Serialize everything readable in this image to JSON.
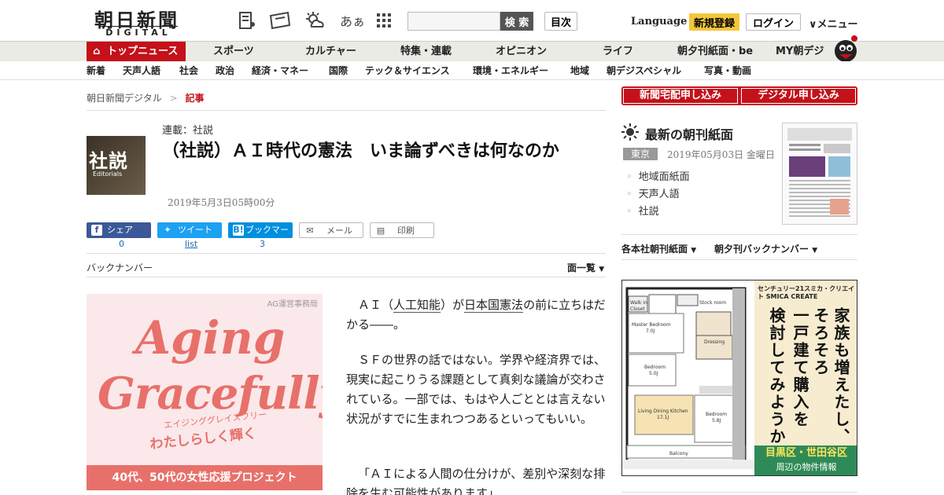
{
  "header": {
    "logo_ja": "朝日新聞",
    "logo_en": "DIGITAL",
    "search_button": "検 索",
    "search_placeholder": "",
    "toc_button": "目次",
    "language": "Language",
    "signup": "新規登録",
    "login": "ログイン",
    "menu": "∨メニュー",
    "font_size_icon_label": "あぁ"
  },
  "nav_primary": [
    "トップニュース",
    "スポーツ",
    "カルチャー",
    "特集・連載",
    "オピニオン",
    "ライフ",
    "朝夕刊紙面・be",
    "MY朝デジ"
  ],
  "nav_secondary": [
    "新着",
    "天声人語",
    "社会",
    "政治",
    "経済・マネー",
    "国際",
    "テック＆サイエンス",
    "環境・エネルギー",
    "地域",
    "朝デジスペシャル",
    "写真・動画"
  ],
  "breadcrumb": {
    "home": "朝日新聞デジタル",
    "sep": ">",
    "current": "記事"
  },
  "article": {
    "thumb_ja": "社説",
    "thumb_en": "Editorials",
    "series": "連載：社説",
    "title": "（社説）ＡＩ時代の憲法　いま論ずべきは何なのか",
    "date": "2019年5月3日05時00分",
    "share": {
      "facebook": "シェア",
      "twitter": "ツイート",
      "hatena": "ブックマーク",
      "mail": "メール",
      "print": "印刷"
    },
    "counts": {
      "facebook": "0",
      "twitter": "list",
      "hatena": "3"
    },
    "back_number": "バックナンバー",
    "page_list": "面一覧",
    "body": {
      "p1_a": "ＡＩ（",
      "p1_link1": "人工知能",
      "p1_b": "）が",
      "p1_link2": "日本国憲法",
      "p1_c": "の前に立ちはだかる――。",
      "p2": "ＳＦの世界の話ではない。学界や経済界では、現実に起こりうる課題として真剣な議論が交わされている。一部では、もはや人ごととは言えない状況がすでに生まれつつあるといってもいい。",
      "p3": "「ＡＩによる人間の仕分けが、差別や深刻な排除を生む可能性があります」"
    }
  },
  "ad_left": {
    "source": "AG運営事務局",
    "line1": "Aging",
    "line2": "Gracefully",
    "kana": "エイジンググレイスフリー",
    "tagline": "わたしらしく輝く",
    "footer": "40代、50代の女性応援プロジェクト",
    "accent": "#e8706a"
  },
  "sidebar": {
    "btn_home_delivery": "新聞宅配申し込み",
    "btn_digital": "デジタル申し込み",
    "latest_title": "最新の朝刊紙面",
    "edition": "東京",
    "issue_date": "2019年05月03日 金曜日",
    "list": [
      "地域面紙面",
      "天声人語",
      "社説"
    ],
    "link_each": "各本社朝刊紙面",
    "link_back": "朝夕刊バックナンバー"
  },
  "ad_right": {
    "brand": "センチュリー21スミカ・クリエイト SMICA CREATE",
    "col1": "家族も増えたし、",
    "col2": "そろそろ",
    "col3": "一戸建て購入を",
    "col4": "検討してみようか。",
    "foot1": "目黒区・世田谷区",
    "foot2": "周辺の物件情報",
    "rooms": [
      "Walk in Closet",
      "Master Bedroom 7.0J",
      "Bedroom 5.0J",
      "Living Dining Kitchen 17.1J",
      "Bedroom 5.8J",
      "Balcony"
    ]
  },
  "colors": {
    "brand_red": "#c4111a",
    "signup_yellow": "#f5c63c",
    "facebook": "#3b5998",
    "twitter": "#1da1f2",
    "hatena": "#008fde"
  }
}
